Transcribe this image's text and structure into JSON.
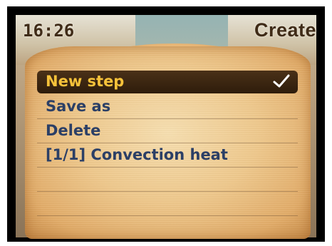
{
  "status_bar": {
    "time": "16:26",
    "title": "Create"
  },
  "menu": {
    "items": [
      {
        "label": "New step",
        "selected": true,
        "checked": true
      },
      {
        "label": "Save as",
        "selected": false
      },
      {
        "label": "Delete",
        "selected": false
      },
      {
        "label": "[1/1] Convection heat",
        "selected": false
      },
      {
        "label": "",
        "selected": false
      },
      {
        "label": "",
        "selected": false
      }
    ]
  },
  "icons": {
    "selected_indicator": "checkmark-icon"
  },
  "colors": {
    "highlight_bg": "#3a2510",
    "highlight_text": "#f6c23a",
    "item_text": "#2b3f66",
    "header_text": "#3f2b17"
  }
}
